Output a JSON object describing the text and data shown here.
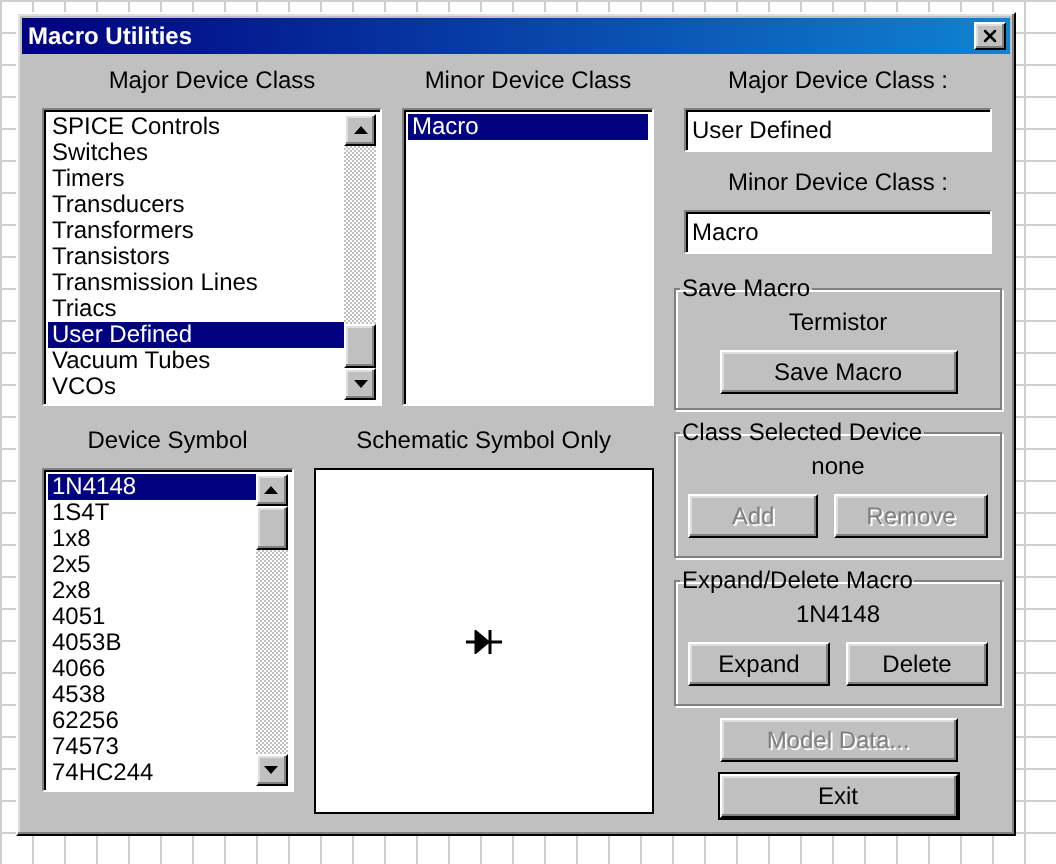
{
  "window": {
    "title": "Macro Utilities"
  },
  "major_class_list": {
    "label": "Major Device Class",
    "items": [
      {
        "text": "SPICE Controls",
        "selected": false
      },
      {
        "text": "Switches",
        "selected": false
      },
      {
        "text": "Timers",
        "selected": false
      },
      {
        "text": "Transducers",
        "selected": false
      },
      {
        "text": "Transformers",
        "selected": false
      },
      {
        "text": "Transistors",
        "selected": false
      },
      {
        "text": "Transmission Lines",
        "selected": false
      },
      {
        "text": "Triacs",
        "selected": false
      },
      {
        "text": "User Defined",
        "selected": true
      },
      {
        "text": "Vacuum Tubes",
        "selected": false
      },
      {
        "text": "VCOs",
        "selected": false
      }
    ]
  },
  "minor_class_list": {
    "label": "Minor Device Class",
    "items": [
      {
        "text": "Macro",
        "selected": true
      }
    ]
  },
  "major_class_field": {
    "label": "Major Device Class :",
    "value": "User Defined"
  },
  "minor_class_field": {
    "label": "Minor Device Class :",
    "value": "Macro"
  },
  "save_macro": {
    "title": "Save Macro",
    "device": "Termistor",
    "buttons": [
      {
        "label": "Save Macro",
        "disabled": false
      }
    ]
  },
  "device_symbol_list": {
    "label": "Device Symbol",
    "items": [
      {
        "text": "1N4148",
        "selected": true
      },
      {
        "text": "1S4T",
        "selected": false
      },
      {
        "text": "1x8",
        "selected": false
      },
      {
        "text": "2x5",
        "selected": false
      },
      {
        "text": "2x8",
        "selected": false
      },
      {
        "text": "4051",
        "selected": false
      },
      {
        "text": "4053B",
        "selected": false
      },
      {
        "text": "4066",
        "selected": false
      },
      {
        "text": "4538",
        "selected": false
      },
      {
        "text": "62256",
        "selected": false
      },
      {
        "text": "74573",
        "selected": false
      },
      {
        "text": "74HC244",
        "selected": false
      }
    ]
  },
  "schematic_preview": {
    "label": "Schematic Symbol Only"
  },
  "class_selected_device": {
    "title": "Class Selected Device",
    "device": "none",
    "buttons": [
      {
        "label": "Add",
        "disabled": true
      },
      {
        "label": "Remove",
        "disabled": true
      }
    ]
  },
  "expand_delete_macro": {
    "title": "Expand/Delete Macro",
    "device": "1N4148",
    "buttons": [
      {
        "label": "Expand",
        "disabled": false
      },
      {
        "label": "Delete",
        "disabled": false
      }
    ]
  },
  "buttons": [
    {
      "label": "Model Data...",
      "disabled": true,
      "default": false
    },
    {
      "label": "Exit",
      "disabled": false,
      "default": true
    }
  ]
}
